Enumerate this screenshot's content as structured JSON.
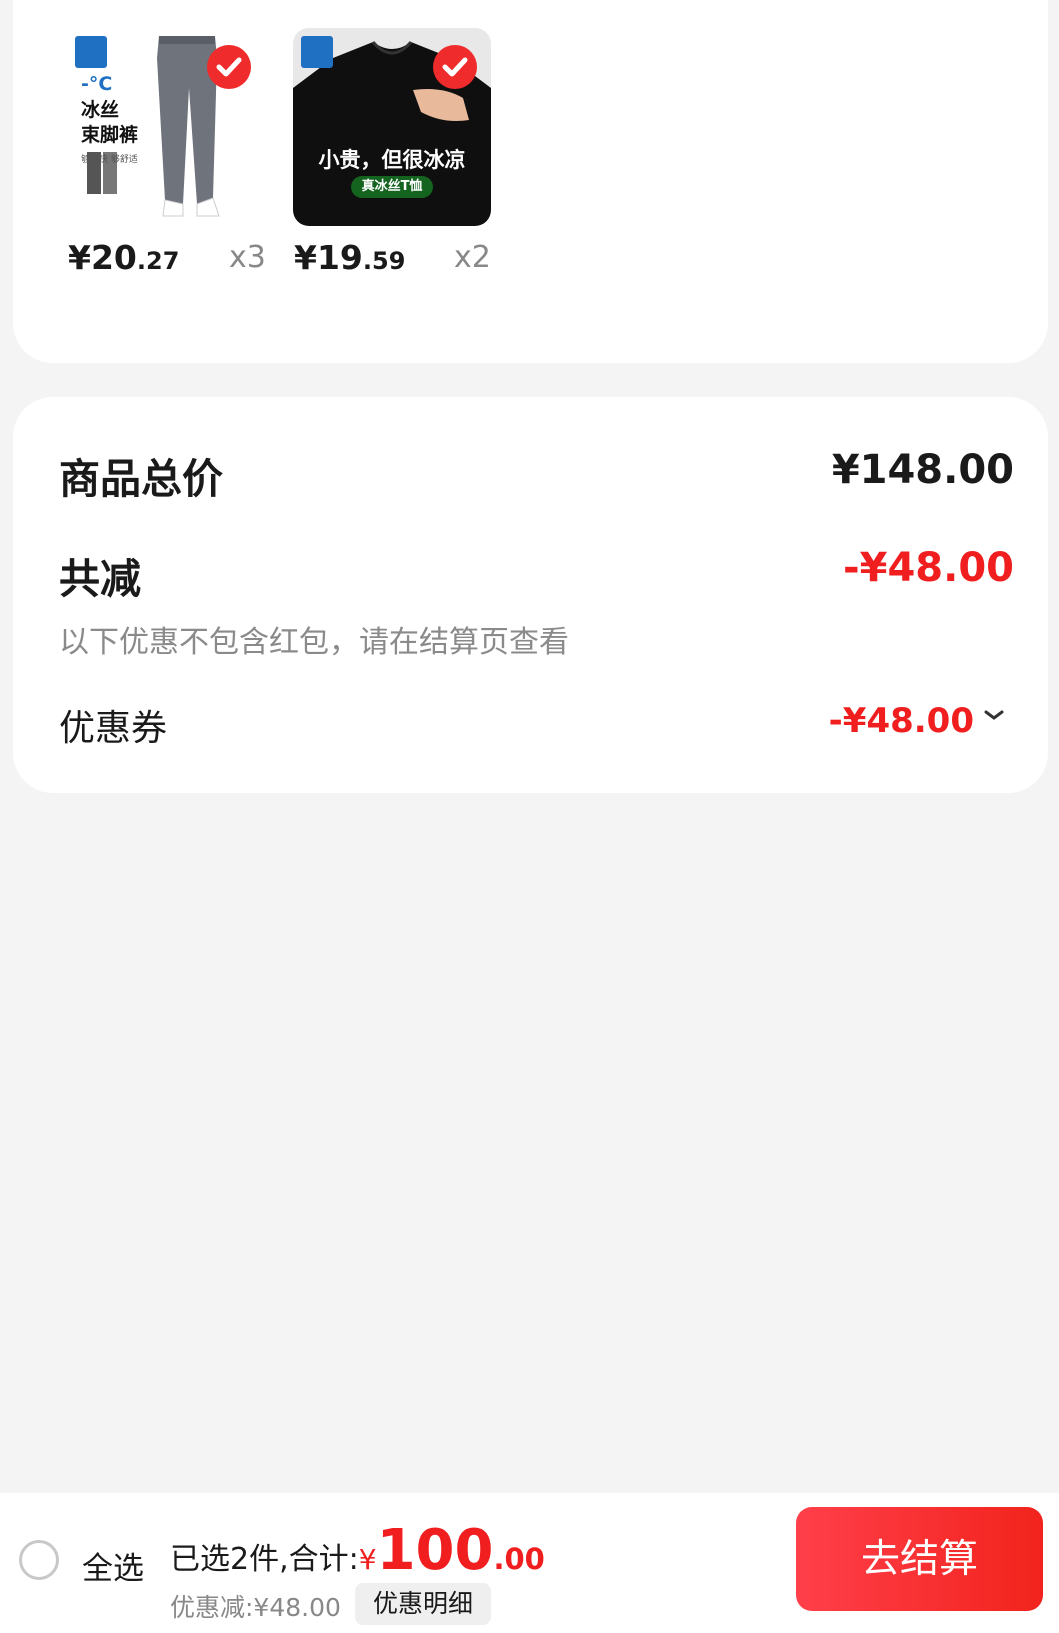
{
  "colors": {
    "accent": "#f01e1e",
    "background": "#f4f4f4",
    "card": "#ffffff",
    "muted": "#888888"
  },
  "products": [
    {
      "image_icon": "ice-silk-jogger-pants-image",
      "brand_icon": "jeanswest-logo",
      "image_text": [
        "-°C",
        "冰丝",
        "束脚裤",
        "够凉快 够舒适"
      ],
      "price_main": "¥20",
      "price_decimal": ".27",
      "quantity": "x3",
      "selected": true
    },
    {
      "image_icon": "black-ice-silk-tshirt-image",
      "brand_icon": "jeanswest-logo",
      "image_text": [
        "小贵，但很冰凉",
        "真冰丝T恤"
      ],
      "price_main": "¥19",
      "price_decimal": ".59",
      "quantity": "x2",
      "selected": true
    }
  ],
  "summary": {
    "total_label": "商品总价",
    "total_value": "¥148.00",
    "reduction_label": "共减",
    "reduction_value": "-¥48.00",
    "reduction_note": "以下优惠不包含红包，请在结算页查看",
    "coupon_label": "优惠券",
    "coupon_value": "-¥48.00"
  },
  "bottom_bar": {
    "select_all_label": "全选",
    "selected_text": "已选2件,合计:",
    "total_currency": "¥",
    "total_main": "100",
    "total_decimal": ".00",
    "discount_text": "优惠减:¥48.00",
    "detail_button": "优惠明细",
    "checkout_button": "去结算"
  }
}
